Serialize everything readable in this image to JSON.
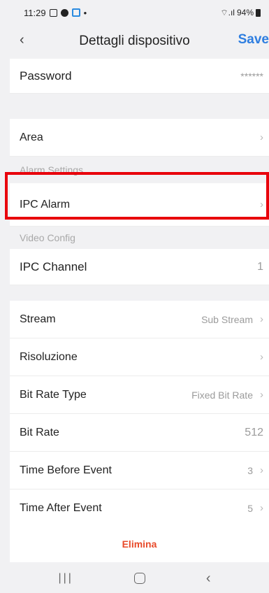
{
  "status_bar": {
    "time": "11:29",
    "dot": "•",
    "battery_text": "94%",
    "signal": "⌔.ıl"
  },
  "header": {
    "back_icon": "‹",
    "title": "Dettagli dispositivo",
    "save_label": "Save"
  },
  "rows": {
    "password": {
      "label": "Password",
      "value": "******"
    },
    "area": {
      "label": "Area"
    },
    "alarm_section": "Alarm Settings",
    "ipc_alarm": {
      "label": "IPC Alarm"
    },
    "video_section": "Video Config",
    "ipc_channel": {
      "label": "IPC Channel",
      "value": "1"
    },
    "stream": {
      "label": "Stream",
      "value": "Sub Stream"
    },
    "risoluzione": {
      "label": "Risoluzione"
    },
    "bit_rate_type": {
      "label": "Bit Rate Type",
      "value": "Fixed Bit Rate"
    },
    "bit_rate": {
      "label": "Bit Rate",
      "value": "512"
    },
    "time_before": {
      "label": "Time Before Event",
      "value": "3"
    },
    "time_after": {
      "label": "Time After Event",
      "value": "5"
    }
  },
  "chevron": "›",
  "delete_label": "Elimina",
  "system_nav": {
    "recents": "|||",
    "back": "‹"
  },
  "colors": {
    "accent": "#2e7ee0",
    "delete": "#e84a2a",
    "highlight": "#e8000b"
  }
}
